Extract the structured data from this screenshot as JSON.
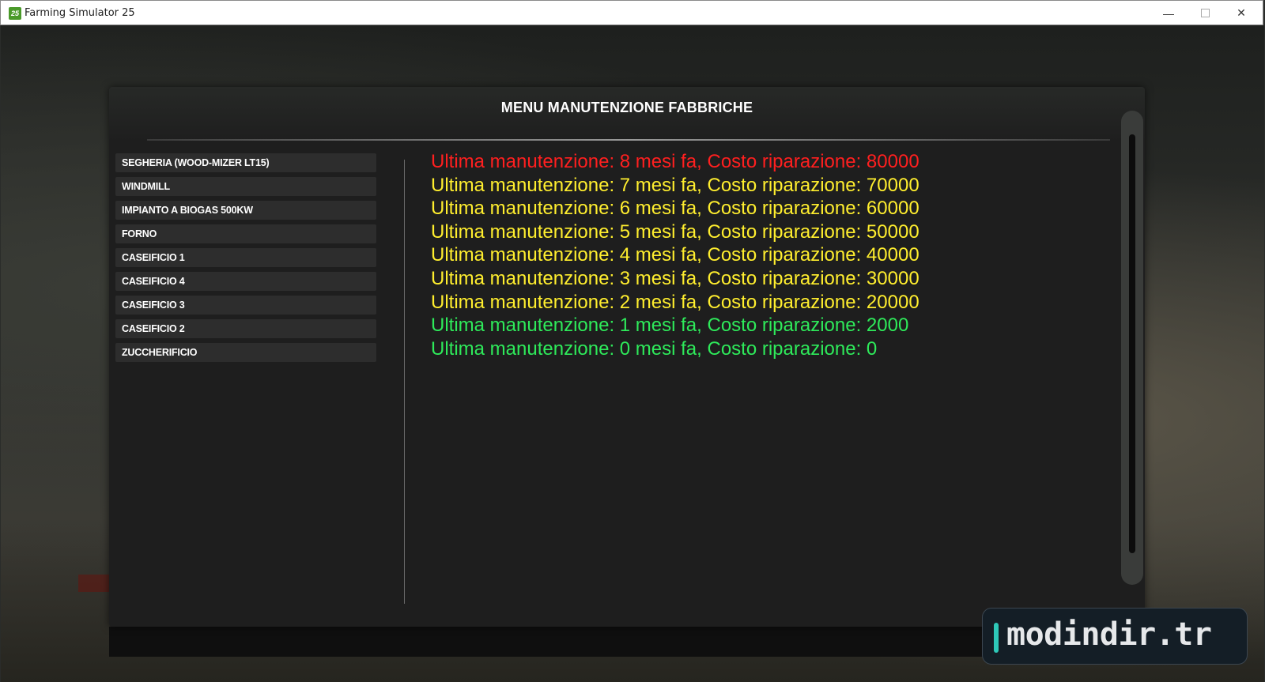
{
  "window": {
    "title": "Farming Simulator 25",
    "icon_label": "25",
    "min_glyph": "—",
    "close_glyph": "✕"
  },
  "dialog": {
    "title": "MENU MANUTENZIONE FABBRICHE"
  },
  "factories": [
    {
      "label": "SEGHERIA (WOOD-MIZER LT15)"
    },
    {
      "label": "WINDMILL"
    },
    {
      "label": "IMPIANTO A BIOGAS 500KW"
    },
    {
      "label": "FORNO"
    },
    {
      "label": "CASEIFICIO 1"
    },
    {
      "label": "CASEIFICIO 4"
    },
    {
      "label": "CASEIFICIO 3"
    },
    {
      "label": "CASEIFICIO 2"
    },
    {
      "label": "ZUCCHERIFICIO"
    }
  ],
  "maintenance": [
    {
      "text": "Ultima manutenzione: 8 mesi fa, Costo riparazione: 80000",
      "color": "#ff1f1f"
    },
    {
      "text": "Ultima manutenzione: 7 mesi fa, Costo riparazione: 70000",
      "color": "#ffee2e"
    },
    {
      "text": "Ultima manutenzione: 6 mesi fa, Costo riparazione: 60000",
      "color": "#ffee2e"
    },
    {
      "text": "Ultima manutenzione: 5 mesi fa, Costo riparazione: 50000",
      "color": "#ffee2e"
    },
    {
      "text": "Ultima manutenzione: 4 mesi fa, Costo riparazione: 40000",
      "color": "#ffee2e"
    },
    {
      "text": "Ultima manutenzione: 3 mesi fa, Costo riparazione: 30000",
      "color": "#ffee2e"
    },
    {
      "text": "Ultima manutenzione: 2 mesi fa, Costo riparazione: 20000",
      "color": "#ffee2e"
    },
    {
      "text": "Ultima manutenzione: 1 mesi fa, Costo riparazione: 2000",
      "color": "#2eea5a"
    },
    {
      "text": "Ultima manutenzione: 0 mesi fa, Costo riparazione: 0",
      "color": "#2eea5a"
    }
  ],
  "watermark": {
    "text": "modindir.tr",
    "accent": "#2ec8b8"
  }
}
